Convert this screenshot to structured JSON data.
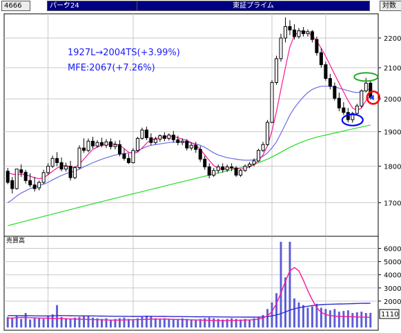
{
  "header": {
    "code": "4666",
    "name": "パーク24",
    "market": "東証プライム",
    "scale_label": "対数"
  },
  "colors": {
    "up_candle": "#ffffff",
    "down_candle": "#000000",
    "ma_short": "#ff1493",
    "ma_mid": "#6a6ae6",
    "ma_long": "#22dd22",
    "annotation": "#1a1aff",
    "circle_red": "#ff0000",
    "circle_blue": "#0000ff",
    "circle_green": "#22aa22",
    "volume_bar": "#5b5bd6"
  },
  "chart_data": [
    {
      "type": "candlestick",
      "title": "",
      "yscale": "log",
      "ylim": [
        1620,
        2280
      ],
      "yticks": [
        1700,
        1800,
        1900,
        2000,
        2100,
        2200
      ],
      "annotations": [
        "1927L→2004TS(+3.99%)",
        "MFE:2067(+7.26%)"
      ],
      "candles": [
        [
          1786,
          1795,
          1755,
          1750
        ],
        [
          1760,
          1770,
          1738,
          1725
        ],
        [
          1738,
          1792,
          1792,
          1735
        ],
        [
          1790,
          1805,
          1782,
          1770
        ],
        [
          1783,
          1790,
          1760,
          1752
        ],
        [
          1760,
          1780,
          1748,
          1742
        ],
        [
          1748,
          1770,
          1738,
          1730
        ],
        [
          1740,
          1760,
          1755,
          1733
        ],
        [
          1755,
          1790,
          1782,
          1750
        ],
        [
          1782,
          1808,
          1800,
          1776
        ],
        [
          1800,
          1830,
          1822,
          1795
        ],
        [
          1822,
          1840,
          1810,
          1800
        ],
        [
          1810,
          1825,
          1792,
          1786
        ],
        [
          1792,
          1810,
          1800,
          1785
        ],
        [
          1800,
          1815,
          1768,
          1760
        ],
        [
          1768,
          1800,
          1796,
          1764
        ],
        [
          1796,
          1860,
          1852,
          1792
        ],
        [
          1852,
          1880,
          1845,
          1838
        ],
        [
          1845,
          1880,
          1872,
          1840
        ],
        [
          1872,
          1885,
          1858,
          1850
        ],
        [
          1858,
          1875,
          1868,
          1852
        ],
        [
          1868,
          1882,
          1860,
          1854
        ],
        [
          1860,
          1878,
          1870,
          1852
        ],
        [
          1870,
          1880,
          1856,
          1848
        ],
        [
          1856,
          1872,
          1862,
          1848
        ],
        [
          1862,
          1875,
          1835,
          1828
        ],
        [
          1835,
          1850,
          1822,
          1816
        ],
        [
          1822,
          1836,
          1810,
          1806
        ],
        [
          1810,
          1852,
          1845,
          1808
        ],
        [
          1845,
          1885,
          1880,
          1840
        ],
        [
          1880,
          1912,
          1905,
          1876
        ],
        [
          1905,
          1915,
          1882,
          1875
        ],
        [
          1882,
          1895,
          1868,
          1860
        ],
        [
          1868,
          1885,
          1878,
          1862
        ],
        [
          1878,
          1892,
          1888,
          1870
        ],
        [
          1888,
          1898,
          1880,
          1872
        ],
        [
          1880,
          1895,
          1890,
          1874
        ],
        [
          1890,
          1902,
          1876,
          1868
        ],
        [
          1876,
          1888,
          1868,
          1860
        ],
        [
          1868,
          1880,
          1872,
          1860
        ],
        [
          1872,
          1878,
          1852,
          1845
        ],
        [
          1852,
          1868,
          1860,
          1845
        ],
        [
          1860,
          1870,
          1848,
          1838
        ],
        [
          1848,
          1858,
          1820,
          1812
        ],
        [
          1820,
          1830,
          1798,
          1790
        ],
        [
          1798,
          1808,
          1775,
          1766
        ],
        [
          1775,
          1795,
          1788,
          1770
        ],
        [
          1788,
          1805,
          1798,
          1780
        ],
        [
          1798,
          1808,
          1790,
          1782
        ],
        [
          1790,
          1805,
          1798,
          1784
        ],
        [
          1798,
          1808,
          1795,
          1786
        ],
        [
          1795,
          1800,
          1775,
          1770
        ],
        [
          1775,
          1792,
          1788,
          1770
        ],
        [
          1788,
          1805,
          1800,
          1784
        ],
        [
          1800,
          1812,
          1806,
          1794
        ],
        [
          1806,
          1822,
          1815,
          1800
        ],
        [
          1815,
          1850,
          1845,
          1812
        ],
        [
          1845,
          1870,
          1862,
          1840
        ],
        [
          1862,
          1935,
          1928,
          1858
        ],
        [
          1928,
          2060,
          2052,
          1925
        ],
        [
          2052,
          2140,
          2130,
          2045
        ],
        [
          2130,
          2215,
          2200,
          2120
        ],
        [
          2200,
          2272,
          2240,
          2185
        ],
        [
          2240,
          2262,
          2228,
          2210
        ],
        [
          2228,
          2248,
          2205,
          2195
        ],
        [
          2205,
          2235,
          2225,
          2198
        ],
        [
          2225,
          2238,
          2215,
          2205
        ],
        [
          2215,
          2230,
          2222,
          2205
        ],
        [
          2222,
          2228,
          2195,
          2185
        ],
        [
          2195,
          2205,
          2150,
          2140
        ],
        [
          2150,
          2165,
          2110,
          2100
        ],
        [
          2110,
          2120,
          2065,
          2058
        ],
        [
          2065,
          2080,
          2040,
          2030
        ],
        [
          2040,
          2052,
          2002,
          1995
        ],
        [
          2002,
          2020,
          1972,
          1962
        ],
        [
          1972,
          1990,
          1958,
          1950
        ],
        [
          1958,
          1972,
          1936,
          1928
        ],
        [
          1936,
          1960,
          1955,
          1927
        ],
        [
          1955,
          1985,
          1978,
          1950
        ],
        [
          1978,
          2030,
          2025,
          1972
        ],
        [
          2025,
          2067,
          2050,
          2020
        ],
        [
          2050,
          2060,
          2004,
          1998
        ]
      ],
      "ma_short": [
        1782,
        1778,
        1776,
        1778,
        1776,
        1772,
        1768,
        1765,
        1768,
        1776,
        1786,
        1795,
        1800,
        1802,
        1798,
        1796,
        1806,
        1820,
        1835,
        1848,
        1855,
        1860,
        1862,
        1864,
        1864,
        1860,
        1850,
        1840,
        1836,
        1840,
        1852,
        1866,
        1876,
        1880,
        1882,
        1884,
        1886,
        1886,
        1882,
        1878,
        1874,
        1868,
        1860,
        1848,
        1832,
        1816,
        1802,
        1794,
        1792,
        1794,
        1795,
        1794,
        1792,
        1794,
        1798,
        1804,
        1816,
        1832,
        1858,
        1902,
        1960,
        2030,
        2100,
        2170,
        2208,
        2222,
        2224,
        2220,
        2208,
        2190,
        2165,
        2138,
        2108,
        2078,
        2050,
        2022,
        1995,
        1972,
        1964,
        1972,
        1995,
        2008
      ],
      "ma_mid": [
        1700,
        1708,
        1718,
        1726,
        1732,
        1738,
        1742,
        1746,
        1750,
        1755,
        1762,
        1768,
        1774,
        1779,
        1783,
        1786,
        1792,
        1798,
        1804,
        1810,
        1815,
        1820,
        1824,
        1828,
        1832,
        1834,
        1836,
        1838,
        1840,
        1844,
        1850,
        1856,
        1860,
        1862,
        1864,
        1866,
        1868,
        1869,
        1870,
        1870,
        1869,
        1867,
        1864,
        1860,
        1854,
        1846,
        1838,
        1832,
        1828,
        1824,
        1822,
        1820,
        1818,
        1817,
        1817,
        1818,
        1822,
        1828,
        1838,
        1852,
        1870,
        1895,
        1922,
        1950,
        1972,
        1990,
        2006,
        2020,
        2030,
        2036,
        2040,
        2040,
        2040,
        2038,
        2034,
        2030,
        2026,
        2022,
        2020,
        2022,
        2028,
        2032
      ],
      "ma_long": [
        1640,
        1643,
        1646,
        1649,
        1652,
        1655,
        1658,
        1661,
        1664,
        1667,
        1670,
        1673,
        1676,
        1679,
        1682,
        1685,
        1688,
        1691,
        1694,
        1697,
        1700,
        1703,
        1706,
        1709,
        1712,
        1715,
        1718,
        1721,
        1724,
        1727,
        1730,
        1733,
        1736,
        1739,
        1742,
        1745,
        1748,
        1751,
        1754,
        1757,
        1760,
        1763,
        1766,
        1769,
        1772,
        1775,
        1778,
        1781,
        1784,
        1787,
        1790,
        1793,
        1796,
        1799,
        1802,
        1806,
        1810,
        1815,
        1820,
        1826,
        1833,
        1840,
        1847,
        1854,
        1860,
        1866,
        1871,
        1876,
        1880,
        1884,
        1887,
        1890,
        1893,
        1896,
        1899,
        1902,
        1905,
        1908,
        1911,
        1914,
        1917,
        1920
      ]
    },
    {
      "type": "bar",
      "title": "売買高",
      "ylim": [
        0,
        6500
      ],
      "yticks": [
        2000,
        3000,
        4000,
        5000,
        6000
      ],
      "current_value_label": "1110",
      "values": [
        800,
        700,
        900,
        650,
        1100,
        600,
        750,
        700,
        650,
        900,
        1000,
        1700,
        800,
        700,
        650,
        750,
        800,
        900,
        850,
        750,
        700,
        650,
        700,
        600,
        650,
        700,
        750,
        650,
        600,
        700,
        800,
        900,
        850,
        700,
        650,
        700,
        650,
        600,
        650,
        700,
        650,
        600,
        550,
        650,
        700,
        750,
        700,
        650,
        600,
        650,
        700,
        650,
        600,
        650,
        600,
        700,
        800,
        950,
        1400,
        1900,
        2600,
        6500,
        3800,
        6500,
        2200,
        1900,
        1700,
        1500,
        1600,
        1800,
        1500,
        1400,
        1300,
        1400,
        1200,
        1250,
        1300,
        1100,
        1150,
        1200,
        1100,
        1110
      ],
      "avg_line": [
        900,
        900,
        895,
        890,
        890,
        885,
        880,
        880,
        875,
        875,
        880,
        900,
        900,
        895,
        890,
        885,
        880,
        880,
        880,
        875,
        870,
        865,
        860,
        855,
        850,
        850,
        850,
        845,
        840,
        840,
        845,
        850,
        850,
        845,
        840,
        838,
        835,
        830,
        828,
        825,
        822,
        820,
        815,
        812,
        810,
        808,
        805,
        800,
        798,
        796,
        794,
        792,
        790,
        788,
        786,
        786,
        790,
        800,
        830,
        880,
        950,
        1050,
        1180,
        1320,
        1420,
        1500,
        1560,
        1610,
        1660,
        1700,
        1730,
        1750,
        1760,
        1770,
        1780,
        1790,
        1800,
        1810,
        1820,
        1830,
        1835,
        1840
      ],
      "ma_line": [
        700,
        720,
        740,
        760,
        750,
        740,
        730,
        720,
        710,
        700,
        690,
        680,
        670,
        660,
        650,
        640,
        630,
        620,
        610,
        600,
        590,
        580,
        570,
        560,
        560,
        560,
        570,
        580,
        590,
        600,
        610,
        620,
        630,
        640,
        640,
        640,
        630,
        620,
        610,
        600,
        590,
        580,
        570,
        560,
        550,
        540,
        530,
        520,
        520,
        520,
        530,
        540,
        550,
        560,
        570,
        590,
        640,
        720,
        880,
        1200,
        1800,
        2600,
        3500,
        4300,
        4550,
        4300,
        3600,
        2800,
        2100,
        1500,
        1150,
        980,
        900,
        860,
        840,
        830,
        820,
        810,
        800,
        790,
        780,
        770
      ]
    }
  ]
}
